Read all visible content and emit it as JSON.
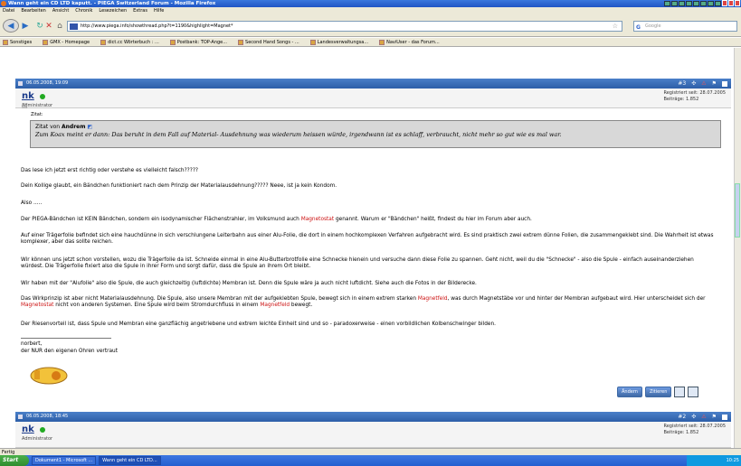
{
  "window": {
    "title": "Wann geht ein CD LTD kaputt. - PIEGA Switzerland Forum - Mozilla Firefox"
  },
  "menu": [
    "Datei",
    "Bearbeiten",
    "Ansicht",
    "Chronik",
    "Lesezeichen",
    "Extras",
    "Hilfe"
  ],
  "nav": {
    "url": "http://www.piega.info/showthread.php?t=1190&highlight=Magnet*",
    "search_placeholder": "Google"
  },
  "bookmarks": [
    "Sonstiges",
    "GMX - Homepage",
    "dict.cc Wörterbuch : ...",
    "Postbank: TOP-Ange...",
    "Second Hand Songs - ...",
    "Landesverwaltungsa...",
    "NaviUser - das Forum..."
  ],
  "post1": {
    "date": "06.05.2008, 19:09",
    "number": "#3",
    "username": "nk",
    "role": "Administrator",
    "registered": "Registriert seit: 28.07.2005",
    "posts": "Beiträge: 1.852",
    "quote_label": "Zitat:",
    "quote_prefix": "Zitat von",
    "quote_author": "Andrem",
    "quote_text": "Zum Koax meint er dann: Das beruht in dem Fall auf Material- Ausdehnung was wiederum heissen würde, irgendwann ist es schlaff, verbraucht, nicht mehr so gut wie es mal war.",
    "p1": "Das lese ich jetzt erst richtig oder verstehe es vielleicht falsch?????",
    "p2": "Dein Kollige glaubt, ein Bändchen funktioniert nach dem Prinzip der Materialausdehnung????? Neee, ist ja kein Kondom.",
    "p3": "Also .....",
    "p4a": "Der PIEGA-Bändchen ist KEIN Bändchen, sondern ein isodynamischer Flächenstrahler, im Volksmund auch ",
    "p4kw": "Magnetostat",
    "p4b": " genannt. Warum er \"Bändchen\" heißt, findest du hier im Forum aber auch.",
    "p5": "Auf einer Trägerfolie befindet sich eine hauchdünne in sich verschlungene Leiterbahn aus einer Alu-Folie, die dort in einem hochkomplexen Verfahren aufgebracht wird. Es sind praktisch zwei extrem dünne Folien, die zusammengeklebt sind. Die Wahrheit ist etwas komplexer, aber das sollte reichen.",
    "p6": "Wir können uns jetzt schon vorstellen, wozu die Trägerfolie da ist. Schneide einmal in eine Alu-Butterbrotfolie eine Schnecke hienein und versuche dann diese Folie zu spannen. Geht nicht, weil du die \"Schnecke\" - also die Spule - einfach auseinanderziehen würdest. Die Trägerfolie fixiert also die Spule in ihrer Form und sorgt dafür, dass die Spule an ihrem Ort bleibt.",
    "p7": "Wir haben mit der \"Alufolie\" also die Spule, die auch gleichzeitig (luftdichte) Membran ist. Denn die Spule wäre ja auch nicht luftdicht. Siehe auch die Fotos in der Bilderecke.",
    "p8a": "Das Wirkprinzip ist aber nicht Materialausdehnung. Die Spule, also unsere Membran mit der aufgeklebten Spule, bewegt sich in einem extrem starken ",
    "p8kw1": "Magnetfeld",
    "p8b": ", was durch Magnetstäbe vor und hinter der Membran aufgebaut wird. Hier unterscheidet sich der ",
    "p8kw2": "Magnetostat",
    "p8c": " nicht von anderen Systemen. Eine Spule wird beim Stromdurchfluss in einem ",
    "p8kw3": "Magnetfeld",
    "p8d": " bewegt.",
    "p9": "Der Riesenvorteil ist, dass Spule und Membran eine ganzflächig angetriebene und extrem leichte Einheit sind und so - paradoxerweise - einen vorbildlichen Kolbenschwinger bilden.",
    "sig1": "norbert,",
    "sig2": "der NUR den eigenen Ohren vertraut",
    "btn_edit": "Ändern",
    "btn_quote": "Zitieren"
  },
  "post2": {
    "date": "06.05.2008, 18:45",
    "number": "#2",
    "username": "nk",
    "role": "Administrator",
    "registered": "Registriert seit: 28.07.2005",
    "posts": "Beiträge: 1.852"
  },
  "status": "Fertig",
  "taskbar": {
    "start": "Start",
    "tasks": [
      "Dokument1 - Microsoft ...",
      "Wann geht ein CD LTD..."
    ],
    "clock": "10:25"
  },
  "colors": {
    "highlight": "#cc1111",
    "postbar": "#2d5ea8"
  }
}
